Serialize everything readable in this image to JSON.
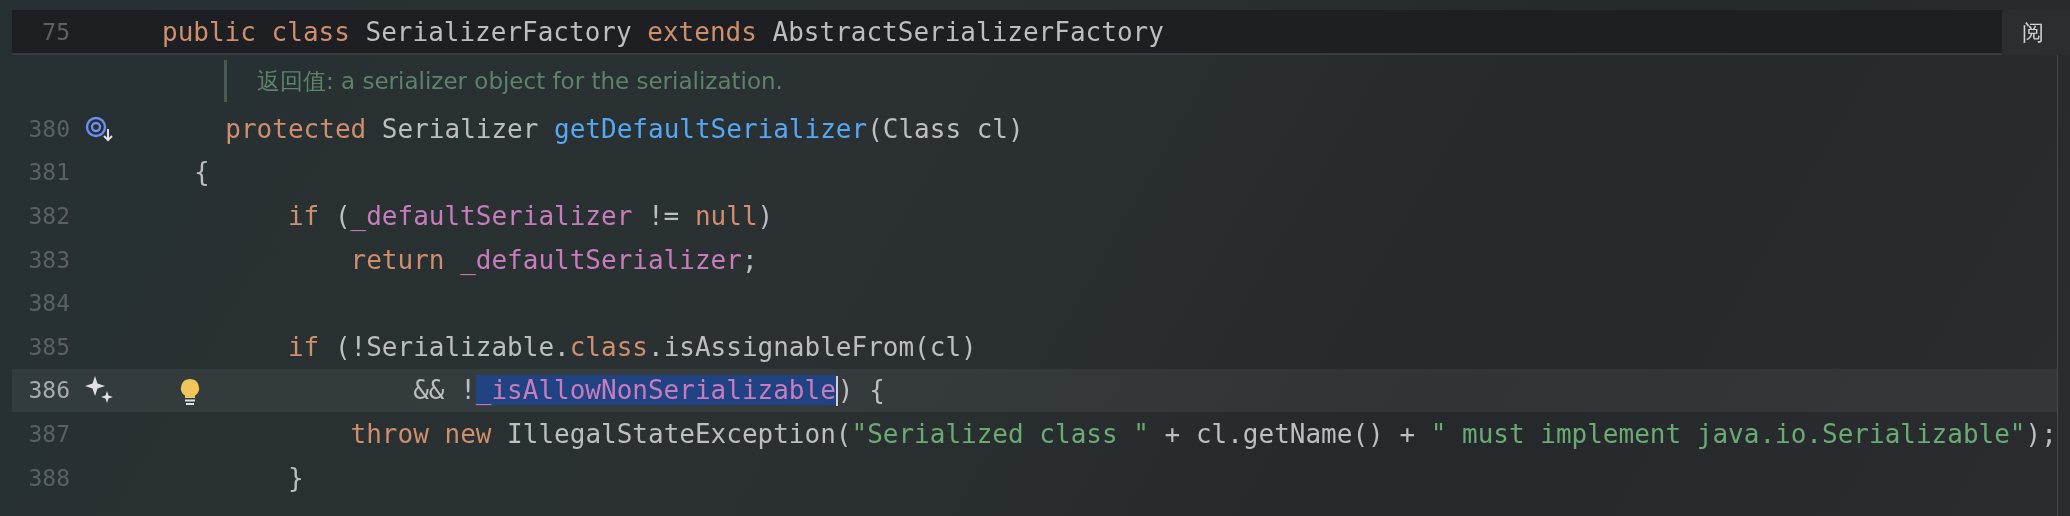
{
  "sticky_header": {
    "line_number": "75",
    "tokens": [
      {
        "text": "public",
        "kind": "keyword",
        "selected": false
      },
      {
        "text": " class",
        "kind": "keyword",
        "selected": false
      },
      {
        "text": " SerializerFactory",
        "kind": "plain",
        "selected": false
      },
      {
        "text": " extends",
        "kind": "keyword",
        "selected": false
      },
      {
        "text": " AbstractSerializerFactory",
        "kind": "plain",
        "selected": false
      }
    ]
  },
  "reader_mode_button": "阅",
  "doc_comment": "返回值: a serializer object for the serialization.",
  "lines": [
    {
      "number": "380",
      "gutter_marker": {
        "kind": "overrides"
      },
      "current": false,
      "tokens": [
        {
          "text": "  protected",
          "kind": "keyword",
          "selected": false
        },
        {
          "text": " Serializer",
          "kind": "plain",
          "selected": false
        },
        {
          "text": " getDefaultSerializer",
          "kind": "method",
          "selected": false
        },
        {
          "text": "(Class cl)",
          "kind": "plain",
          "selected": false
        }
      ]
    },
    {
      "number": "381",
      "current": false,
      "tokens": [
        {
          "text": "{",
          "kind": "plain",
          "selected": false
        }
      ]
    },
    {
      "number": "382",
      "current": false,
      "tokens": [
        {
          "text": "      if",
          "kind": "keyword",
          "selected": false
        },
        {
          "text": " (",
          "kind": "plain",
          "selected": false
        },
        {
          "text": "_defaultSerializer",
          "kind": "field",
          "selected": false
        },
        {
          "text": " !=",
          "kind": "plain",
          "selected": false
        },
        {
          "text": " null",
          "kind": "keyword",
          "selected": false
        },
        {
          "text": ")",
          "kind": "plain",
          "selected": false
        }
      ]
    },
    {
      "number": "383",
      "current": false,
      "tokens": [
        {
          "text": "          return",
          "kind": "keyword",
          "selected": false
        },
        {
          "text": " _defaultSerializer",
          "kind": "field",
          "selected": false
        },
        {
          "text": ";",
          "kind": "plain",
          "selected": false
        }
      ]
    },
    {
      "number": "384",
      "current": false
    },
    {
      "number": "385",
      "current": false,
      "tokens": [
        {
          "text": "      if",
          "kind": "keyword",
          "selected": false
        },
        {
          "text": " (!Serializable.",
          "kind": "plain",
          "selected": false
        },
        {
          "text": "class",
          "kind": "keyword",
          "selected": false
        },
        {
          "text": ".isAssignableFrom(cl)",
          "kind": "plain",
          "selected": false
        }
      ]
    },
    {
      "number": "386",
      "gutter_marker": {
        "kind": "ai"
      },
      "intention_bulb": true,
      "current": true,
      "caret": true,
      "tokens": [
        {
          "text": "              &&",
          "kind": "plain",
          "selected": false
        },
        {
          "text": " !",
          "kind": "plain",
          "selected": false
        },
        {
          "text": "_isAllowNonSerializable",
          "kind": "field",
          "selected": true
        },
        {
          "text": ")",
          "kind": "plain",
          "selected": false
        },
        {
          "text": " {",
          "kind": "plain",
          "selected": false
        }
      ]
    },
    {
      "number": "387",
      "current": false,
      "tokens": [
        {
          "text": "          throw",
          "kind": "keyword",
          "selected": false
        },
        {
          "text": " new",
          "kind": "keyword",
          "selected": false
        },
        {
          "text": " IllegalStateException(",
          "kind": "plain",
          "selected": false
        },
        {
          "text": "\"Serialized class \"",
          "kind": "string",
          "selected": false
        },
        {
          "text": " +",
          "kind": "plain",
          "selected": false
        },
        {
          "text": " cl.getName()",
          "kind": "plain",
          "selected": false
        },
        {
          "text": " +",
          "kind": "plain",
          "selected": false
        },
        {
          "text": " \" must implement java.io.Serializable\"",
          "kind": "string",
          "selected": false
        },
        {
          "text": ");",
          "kind": "plain",
          "selected": false
        }
      ]
    },
    {
      "number": "388",
      "current": false,
      "tokens": [
        {
          "text": "      }",
          "kind": "plain",
          "selected": false
        }
      ]
    }
  ]
}
